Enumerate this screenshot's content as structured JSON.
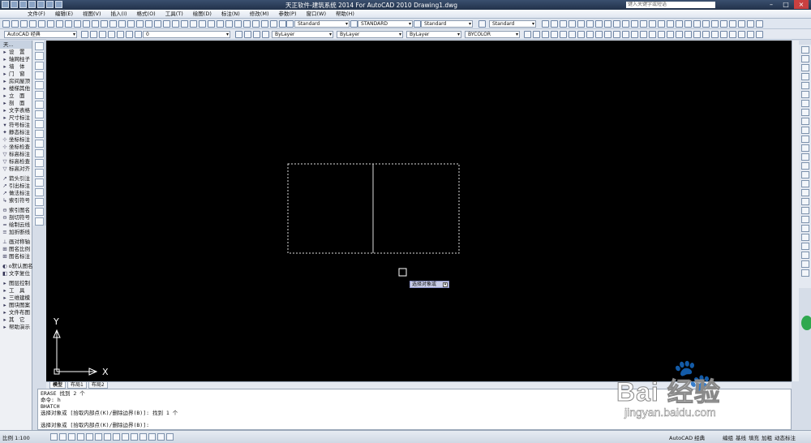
{
  "window": {
    "title": "天正软件-建筑系统 2014  For AutoCAD 2010      Drawing1.dwg",
    "search_placeholder": "键入关键字或短语",
    "minimize": "–",
    "maximize": "□",
    "close": "×"
  },
  "menubar": [
    "文件(F)",
    "编辑(E)",
    "视图(V)",
    "插入(I)",
    "格式(O)",
    "工具(T)",
    "绘图(D)",
    "标注(N)",
    "修改(M)",
    "参数(P)",
    "窗口(W)",
    "帮助(H)"
  ],
  "toolbar1": {
    "text_style": "Standard",
    "dim_style": "STANDARD",
    "table_style": "Standard",
    "mleader_style": "Standard"
  },
  "toolbar2": {
    "workspace": "AutoCAD 经典",
    "layer": "0",
    "color": "ByLayer",
    "linetype": "ByLayer",
    "lineweight": "ByLayer",
    "plotstyle": "BYCOLOR"
  },
  "left_panel": {
    "header": "天...",
    "items": [
      {
        "sym": "▸",
        "label": "设　置"
      },
      {
        "sym": "▸",
        "label": "轴网柱子"
      },
      {
        "sym": "▸",
        "label": "墙　体"
      },
      {
        "sym": "▸",
        "label": "门　窗"
      },
      {
        "sym": "▸",
        "label": "房间屋顶"
      },
      {
        "sym": "▸",
        "label": "楼梯其他"
      },
      {
        "sym": "▸",
        "label": "立　面"
      },
      {
        "sym": "▸",
        "label": "剖　面"
      },
      {
        "sym": "▸",
        "label": "文字表格"
      },
      {
        "sym": "▸",
        "label": "尺寸标注"
      },
      {
        "sym": "▾",
        "label": "符号标注"
      },
      {
        "sym": "✦",
        "label": "静态标注"
      },
      {
        "sym": "⊹",
        "label": "坐标标注"
      },
      {
        "sym": "⊹",
        "label": "坐标检查"
      },
      {
        "sym": "▽",
        "label": "标高标注"
      },
      {
        "sym": "▽",
        "label": "标高检查"
      },
      {
        "sym": "▽",
        "label": "标高对齐"
      },
      {
        "sym": "↗",
        "label": "箭头引注"
      },
      {
        "sym": "↗",
        "label": "引出标注"
      },
      {
        "sym": "↗",
        "label": "做法标注"
      },
      {
        "sym": "↳",
        "label": "索引符号"
      },
      {
        "sym": "⊖",
        "label": "索引图名"
      },
      {
        "sym": "⊖",
        "label": "剖切符号"
      },
      {
        "sym": "≈",
        "label": "绘制云线"
      },
      {
        "sym": "≡",
        "label": "加折断线"
      },
      {
        "sym": "⊥",
        "label": "画对称轴"
      },
      {
        "sym": "⊞",
        "label": "图名比例"
      },
      {
        "sym": "⊞",
        "label": "图名标注"
      },
      {
        "sym": "◐",
        "label": "o默认图名"
      },
      {
        "sym": "◧",
        "label": "文字复位"
      },
      {
        "sym": "▸",
        "label": "图层控制"
      },
      {
        "sym": "▸",
        "label": "工　具"
      },
      {
        "sym": "▸",
        "label": "三维建模"
      },
      {
        "sym": "▸",
        "label": "图块图案"
      },
      {
        "sym": "▸",
        "label": "文件布图"
      },
      {
        "sym": "▸",
        "label": "其　它"
      },
      {
        "sym": "▸",
        "label": "帮助演示"
      }
    ]
  },
  "drawing": {
    "ucs_x": "X",
    "ucs_y": "Y",
    "tooltip": "选择对象或",
    "tooltip_arrow": "▾"
  },
  "layout_tabs": [
    "模型",
    "布局1",
    "布局2"
  ],
  "command_history": [
    "ERASE 找到 2 个",
    "命令: h",
    "BHATCH",
    "选择对象或 [拾取内部点(K)/删除边界(B)]: 找到 1 个"
  ],
  "command_prompt": "选择对象或 [拾取内部点(K)/删除边界(B)]:",
  "statusbar": {
    "scale": "比例 1:100",
    "workspace_btn": "AutoCAD 经典",
    "btn_edit": "编组",
    "btn_base": "基线",
    "btn_fill": "填充",
    "btn_bold": "加粗",
    "btn_dyn": "动态标注"
  },
  "watermark": {
    "brand": "Bai  经验",
    "url": "jingyan.baidu.com"
  },
  "colors": {
    "canvas": "#000000",
    "chrome": "#dfe6f0",
    "titlebar": "#2a3b55"
  }
}
